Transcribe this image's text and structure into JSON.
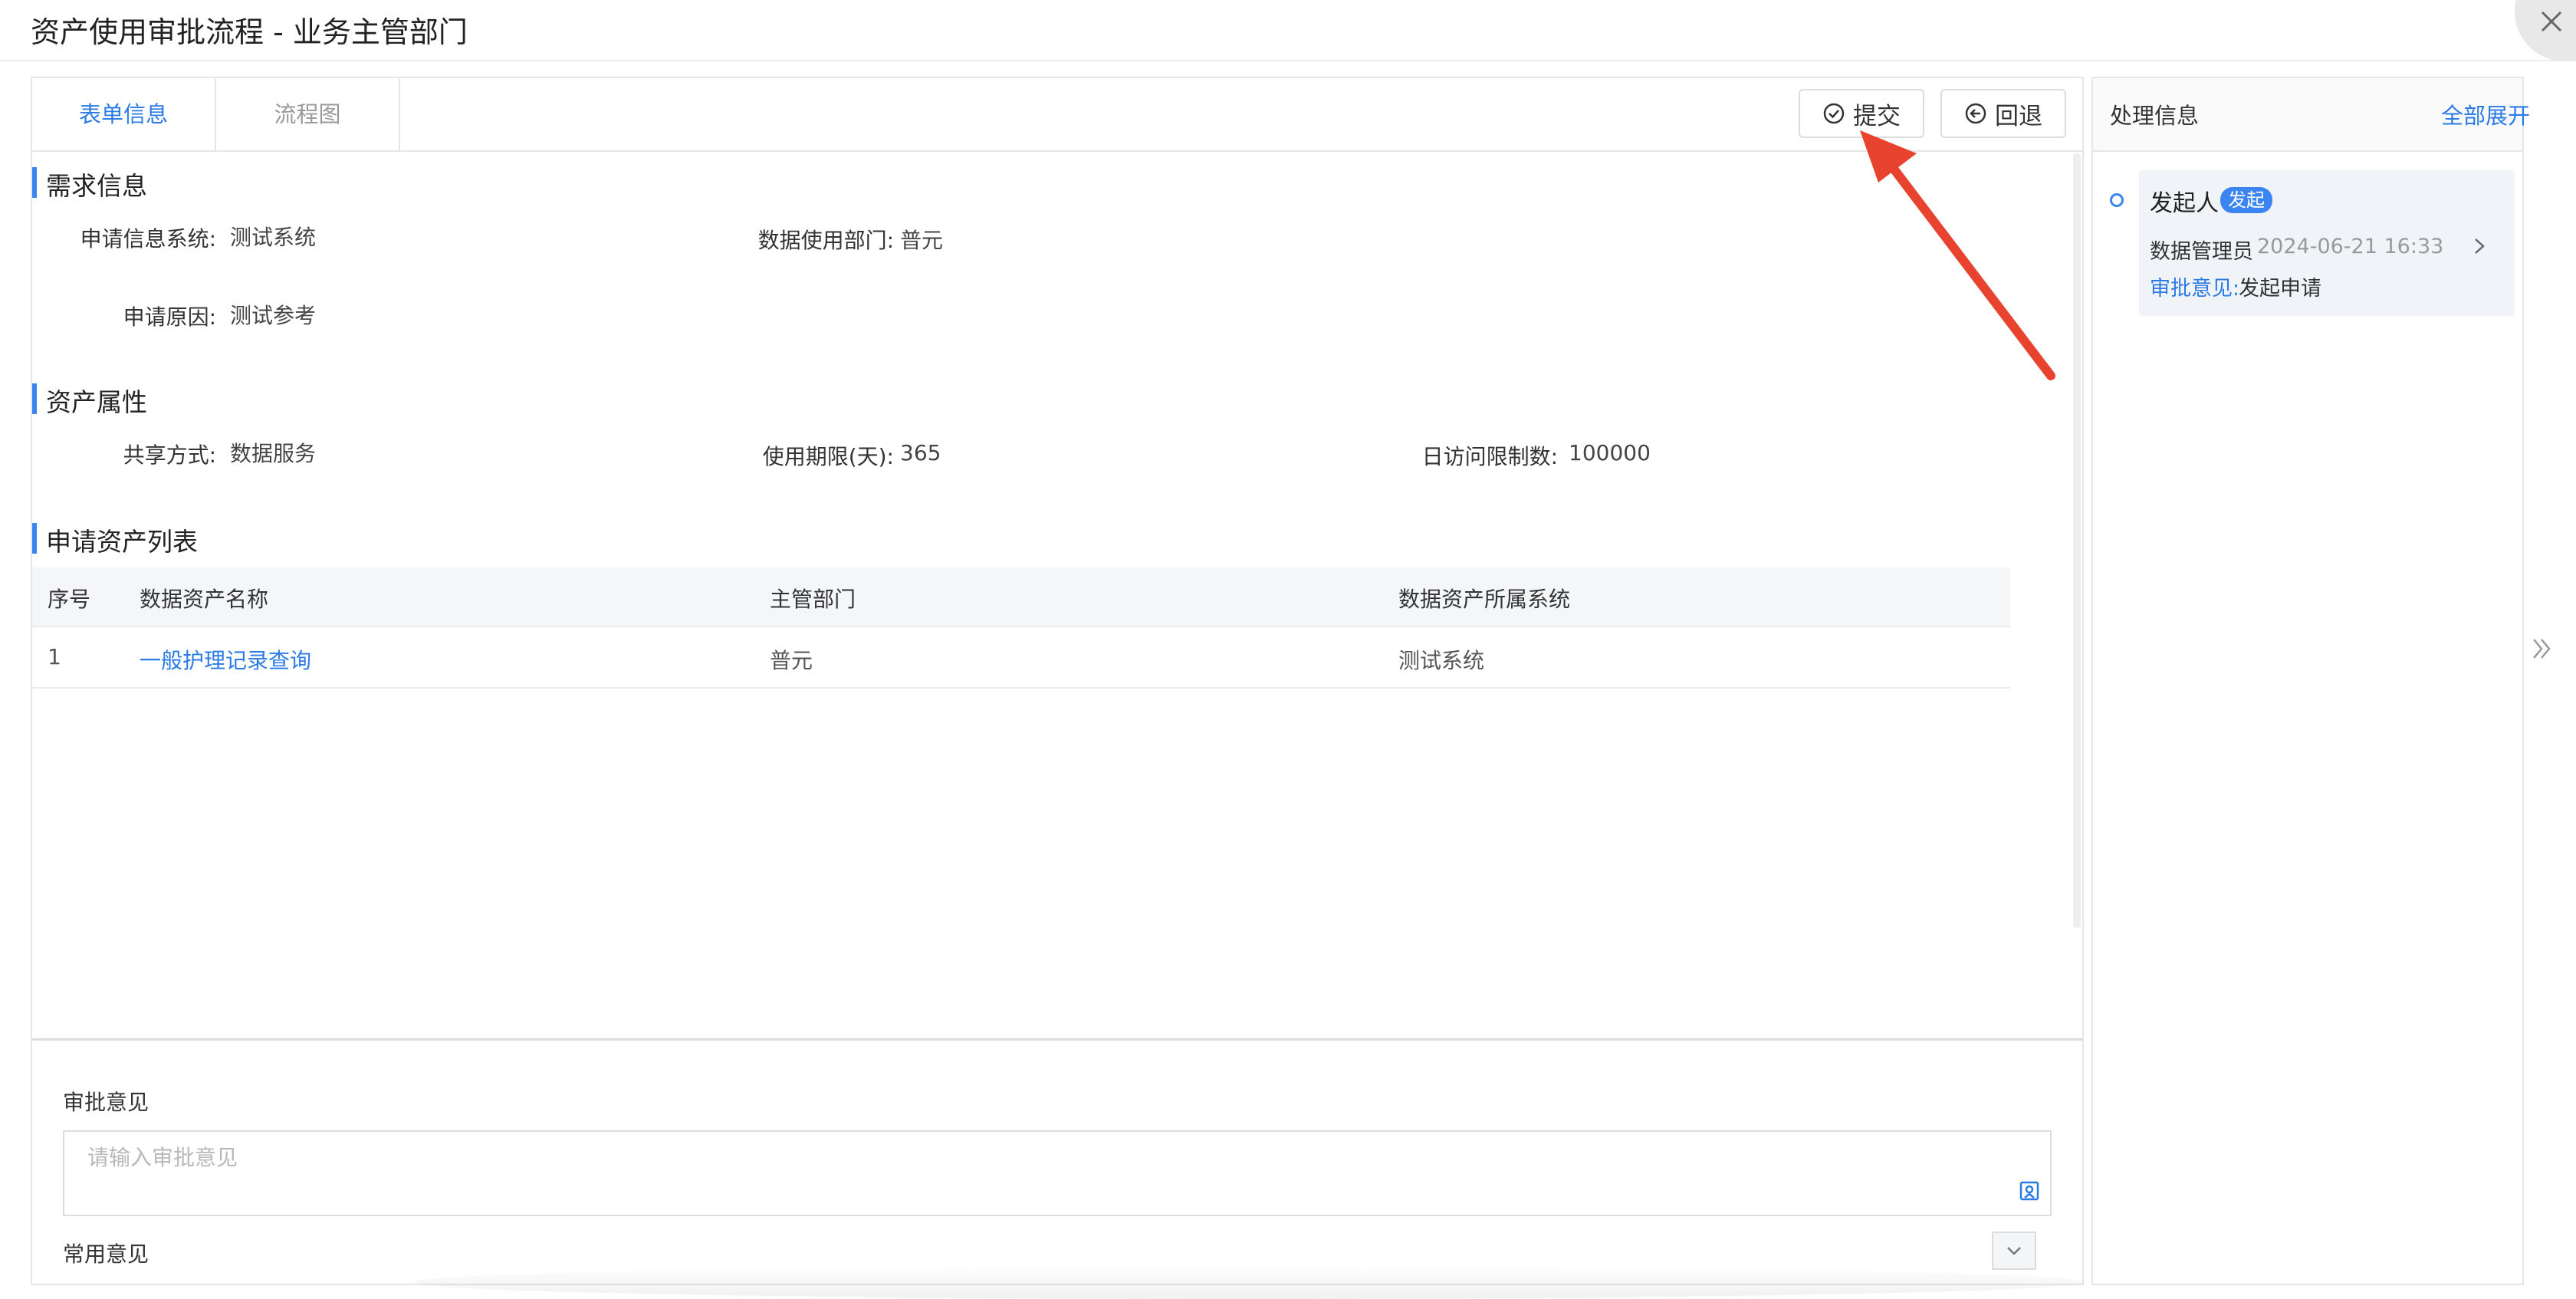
{
  "window": {
    "title": "资产使用审批流程 - 业务主管部门"
  },
  "tabs": [
    {
      "label": "表单信息",
      "active": true
    },
    {
      "label": "流程图",
      "active": false
    }
  ],
  "toolbar": {
    "submit_label": "提交",
    "back_label": "回退"
  },
  "sections": {
    "demand": {
      "title": "需求信息",
      "system_label": "申请信息系统:",
      "system_value": "测试系统",
      "dept_label": "数据使用部门:",
      "dept_value": "普元",
      "reason_label": "申请原因:",
      "reason_value": "测试参考"
    },
    "asset": {
      "title": "资产属性",
      "share_label": "共享方式:",
      "share_value": "数据服务",
      "period_label": "使用期限(天):",
      "period_value": "365",
      "limit_label": "日访问限制数:",
      "limit_value": "100000"
    },
    "list": {
      "title": "申请资产列表",
      "headers": [
        "序号",
        "数据资产名称",
        "主管部门",
        "数据资产所属系统"
      ],
      "rows": [
        [
          "1",
          "一般护理记录查询",
          "普元",
          "测试系统"
        ]
      ]
    }
  },
  "opinion": {
    "label": "审批意见",
    "placeholder": "请输入审批意见",
    "common_label": "常用意见"
  },
  "side": {
    "title": "处理信息",
    "expand_all": "全部展开",
    "node": {
      "role": "发起人",
      "tag": "发起",
      "user": "数据管理员",
      "time": "2024-06-21 16:33",
      "opinion_label": "审批意见:",
      "opinion_value": "发起申请"
    }
  },
  "colors": {
    "accent": "#2c7be5",
    "annotation_arrow": "#e8432e"
  }
}
